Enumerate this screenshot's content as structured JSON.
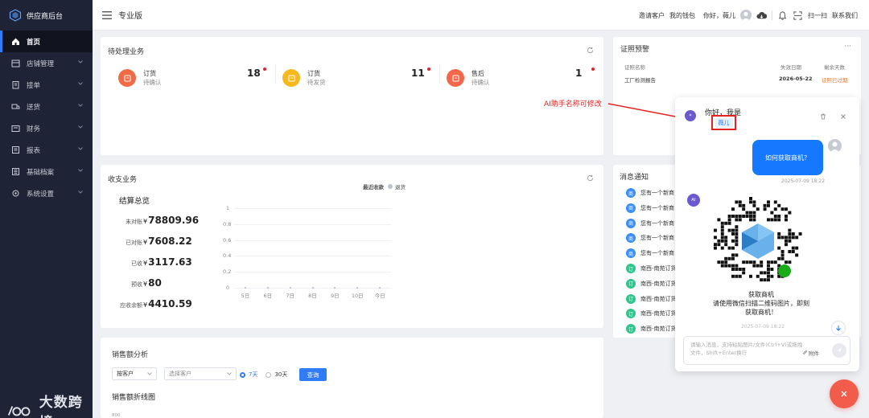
{
  "sidebar": {
    "brand": "供应商后台",
    "items": [
      {
        "label": "首页",
        "active": true,
        "icon": "home-icon"
      },
      {
        "label": "店铺管理",
        "icon": "store-icon"
      },
      {
        "label": "接单",
        "icon": "clipboard-icon"
      },
      {
        "label": "送货",
        "icon": "truck-icon"
      },
      {
        "label": "财务",
        "icon": "wallet-icon"
      },
      {
        "label": "报表",
        "icon": "report-icon"
      },
      {
        "label": "基础档案",
        "icon": "archive-icon"
      },
      {
        "label": "系统设置",
        "icon": "gear-icon"
      }
    ],
    "watermark": "大数跨境"
  },
  "header": {
    "title": "专业版",
    "invite": "邀请客户",
    "wallet": "我的钱包",
    "greeting": "你好，薇儿",
    "scan": "扫一扫",
    "contact": "联系我们"
  },
  "pending": {
    "title": "待处理业务",
    "items": [
      {
        "t1": "订货",
        "t2": "待确认",
        "count": "18",
        "color": "#f06a45"
      },
      {
        "t1": "订货",
        "t2": "待发货",
        "count": "11",
        "color": "#f6b81f"
      },
      {
        "t1": "售后",
        "t2": "待确认",
        "count": "1",
        "color": "#f2674b"
      }
    ]
  },
  "cert": {
    "title": "证照预警",
    "more": "···",
    "columns": [
      "证照名称",
      "失效日期",
      "剩余天数"
    ],
    "rows": [
      [
        "工厂检测报告",
        "2026-05-22",
        "证照已过期"
      ]
    ]
  },
  "income": {
    "title": "收支业务",
    "summary_title": "结算总览",
    "legend": [
      "最近收款",
      "退货"
    ],
    "currency": "¥",
    "rows": [
      {
        "label": "未对账",
        "value": "78809.96"
      },
      {
        "label": "已对账",
        "value": "7608.22"
      },
      {
        "label": "已收",
        "value": "3117.63"
      },
      {
        "label": "预收",
        "value": "80"
      },
      {
        "label": "应收余额",
        "value": "4410.59"
      }
    ]
  },
  "chart_data": {
    "type": "line",
    "categories": [
      "5日",
      "6日",
      "7日",
      "8日",
      "9日",
      "10日",
      "今日"
    ],
    "yticks": [
      "1",
      "0.8",
      "0.6",
      "0.4",
      "0.2",
      "0"
    ],
    "ylim": [
      0,
      1
    ],
    "series": [
      {
        "name": "最近收款",
        "values": [
          0,
          0,
          0,
          0,
          0,
          0,
          0
        ]
      },
      {
        "name": "退货",
        "values": [
          0,
          0,
          0,
          0,
          0,
          0,
          0
        ]
      }
    ],
    "grid": true,
    "legend_position": "top-center"
  },
  "notice": {
    "title": "消息通知",
    "items": [
      {
        "badge": "商",
        "text": "您有一个新商",
        "color": "#3a8ef6"
      },
      {
        "badge": "商",
        "text": "您有一个新商",
        "color": "#3a8ef6"
      },
      {
        "badge": "商",
        "text": "您有一个新商",
        "color": "#3a8ef6"
      },
      {
        "badge": "商",
        "text": "您有一个新商",
        "color": "#3a8ef6"
      },
      {
        "badge": "商",
        "text": "您有一个新商",
        "color": "#3a8ef6"
      },
      {
        "badge": "订",
        "text": "南西-南苑订货",
        "color": "#31c48d"
      },
      {
        "badge": "订",
        "text": "南西-南苑订货",
        "color": "#31c48d"
      },
      {
        "badge": "订",
        "text": "南西-南苑订货",
        "color": "#31c48d"
      },
      {
        "badge": "订",
        "text": "南西-南苑订货",
        "color": "#31c48d"
      },
      {
        "badge": "订",
        "text": "南西-南苑订货",
        "color": "#31c48d"
      }
    ]
  },
  "sales": {
    "title": "销售额分析",
    "by": "按客户",
    "customer_placeholder": "选择客户",
    "opt7": "7天",
    "opt30": "30天",
    "query": "查询",
    "line_title": "销售额折线图",
    "ytop": "800"
  },
  "chat": {
    "hello": "你好，我是",
    "name": "薇儿",
    "user_msg": "如何获取商机？",
    "time1": "2025-07-09 18:22",
    "ai_badge": "AI",
    "reply_title": "获取商机",
    "reply_body1": "请使用微信扫描二维码图片，即刻",
    "reply_body2": "获取商机！",
    "time2": "2025-07-09 18:22",
    "input_placeholder": "请输入消息，支持粘贴图片/文件(Ctrl+V)或拖拽文件，Shift+Enter换行",
    "attach": "附件"
  },
  "annotation": "AI助手名称可修改",
  "colors": {
    "accent": "#1677ff",
    "sidebar": "#1f2336",
    "alert": "#e52222",
    "fab": "#f25c4b"
  }
}
